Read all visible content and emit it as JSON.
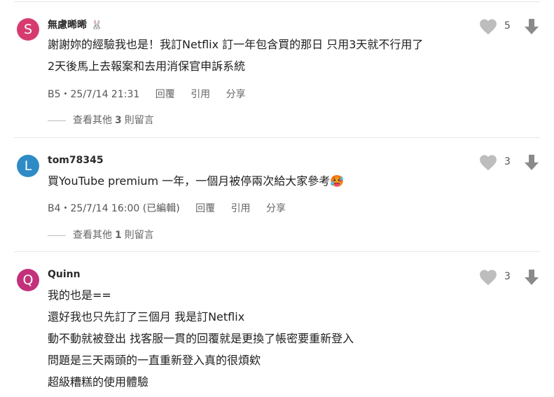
{
  "comments": [
    {
      "avatar_letter": "S",
      "avatar_color": "#d63b6f",
      "author": "無慮晞晞",
      "author_emoji": "🐰",
      "lines": [
        "謝謝妳的經驗我也是！我訂Netflix 訂一年包含買的那日 只用3天就不行用了",
        "2天後馬上去報案和去用消保官申訴系統"
      ],
      "meta": "B5・25/7/14 21:31",
      "reply_label": "回覆",
      "quote_label": "引用",
      "share_label": "分享",
      "likes": "5",
      "more_replies": {
        "prefix": "查看其他",
        "count": "3",
        "suffix": "則留言"
      }
    },
    {
      "avatar_letter": "L",
      "avatar_color": "#2f8bc6",
      "author": "tom78345",
      "lines": [
        "買YouTube premium 一年，一個月被停兩次給大家參考🥵"
      ],
      "meta": "B4・25/7/14 16:00 (已編輯)",
      "reply_label": "回覆",
      "quote_label": "引用",
      "share_label": "分享",
      "likes": "3",
      "more_replies": {
        "prefix": "查看其他",
        "count": "1",
        "suffix": "則留言"
      }
    },
    {
      "avatar_letter": "Q",
      "avatar_color": "#c2317a",
      "author": "Quinn",
      "lines": [
        "我的也是==",
        "還好我也只先訂了三個月 我是訂Netflix",
        "動不動就被登出 找客服一貫的回覆就是更換了帳密要重新登入",
        "問題是三天兩頭的一直重新登入真的很煩欸",
        "超級糟糕的使用體驗"
      ],
      "likes": "3"
    }
  ]
}
